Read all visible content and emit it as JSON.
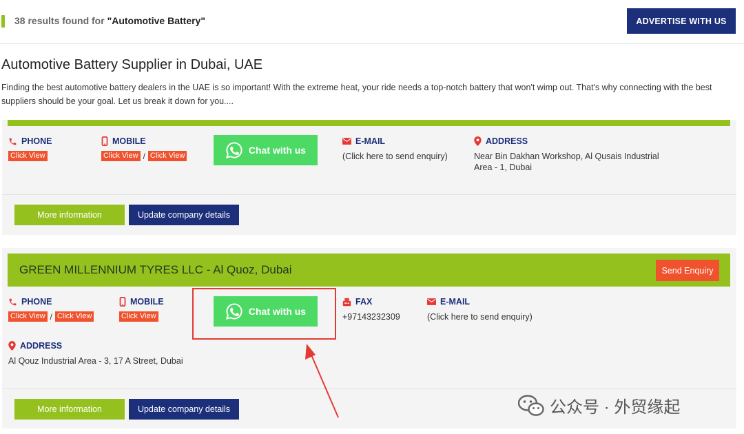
{
  "results": {
    "count_text": "38 results found for",
    "query": "\"Automotive Battery\""
  },
  "advertise_label": "ADVERTISE WITH US",
  "page": {
    "title": "Automotive Battery Supplier in Dubai, UAE",
    "intro": "Finding the best automotive battery dealers in the UAE is so important! With the extreme heat, your ride needs a top-notch battery that won't wimp out. That's why connecting with the best suppliers should be your goal. Let us break it down for you...."
  },
  "labels": {
    "phone": "PHONE",
    "mobile": "MOBILE",
    "email": "E-MAIL",
    "address": "ADDRESS",
    "fax": "FAX",
    "click_view": "Click View",
    "slash": "/",
    "chat": "Chat with us",
    "more_info": "More information",
    "update": "Update company details",
    "send_enquiry": "Send Enquiry",
    "email_value": "(Click here to send enquiry)"
  },
  "listing1": {
    "address": "Near Bin Dakhan Workshop, Al Qusais Industrial Area - 1, Dubai"
  },
  "listing2": {
    "company": "GREEN MILLENNIUM TYRES LLC - Al Quoz, Dubai",
    "fax": "+97143232309",
    "address": "Al Qouz Industrial Area - 3, 17 A Street, Dubai"
  },
  "watermark": {
    "text": "公众号 · 外贸缘起"
  },
  "colors": {
    "navy": "#1b2f7a",
    "lime": "#95c11f",
    "orange": "#f0522d",
    "whatsapp": "#4cd964",
    "annotation_red": "#e53935"
  },
  "icons": [
    "phone-icon",
    "mobile-icon",
    "email-icon",
    "location-pin-icon",
    "fax-icon",
    "whatsapp-icon",
    "wechat-icon"
  ]
}
